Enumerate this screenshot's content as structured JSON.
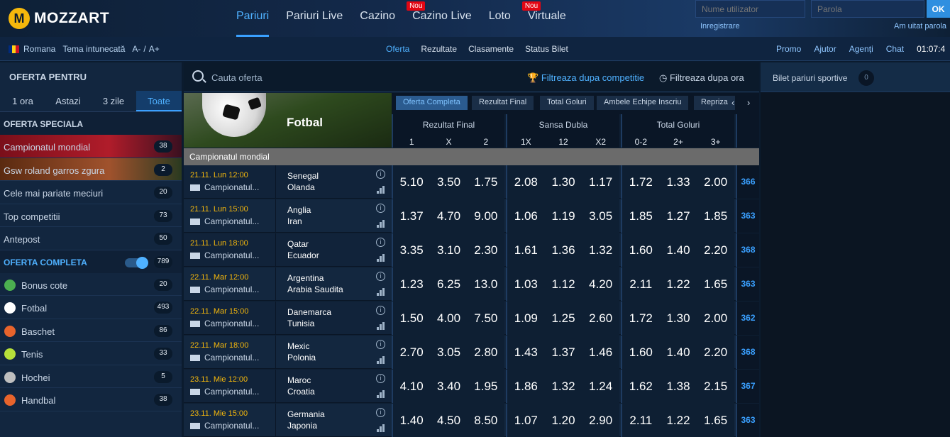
{
  "brand": {
    "logo_letter": "M",
    "name": "MOZZART",
    "accent": "#3aa0ff",
    "gold": "#f5b80c"
  },
  "main_nav": [
    {
      "label": "Pariuri",
      "active": true,
      "badge": ""
    },
    {
      "label": "Pariuri Live",
      "active": false,
      "badge": ""
    },
    {
      "label": "Cazino",
      "active": false,
      "badge": ""
    },
    {
      "label": "Cazino Live",
      "active": false,
      "badge": "Nou"
    },
    {
      "label": "Loto",
      "active": false,
      "badge": ""
    },
    {
      "label": "Virtuale",
      "active": false,
      "badge": "Nou"
    }
  ],
  "login": {
    "user_placeholder": "Nume utilizator",
    "pass_placeholder": "Parola",
    "ok": "OK",
    "register": "Inregistrare",
    "forgot": "Am uitat parola"
  },
  "subbar": {
    "language": "Romana",
    "theme": "Tema intunecată",
    "font_small": "A-",
    "font_sep": "/",
    "font_big": "A+",
    "center": [
      "Oferta",
      "Rezultate",
      "Clasamente",
      "Status Bilet"
    ],
    "right": [
      "Promo",
      "Ajutor",
      "Agenți",
      "Chat"
    ],
    "clock": "01:07:4"
  },
  "sidebar": {
    "title": "OFERTA PENTRU",
    "tabs": [
      "1 ora",
      "Astazi",
      "3 zile",
      "Toate"
    ],
    "active_tab": 3,
    "special_title": "OFERTA SPECIALA",
    "special": [
      {
        "label": "Campionatul mondial",
        "count": "38"
      },
      {
        "label": "Gsw roland garros zgura",
        "count": "2"
      },
      {
        "label": "Cele mai pariate meciuri",
        "count": "20"
      },
      {
        "label": "Top competitii",
        "count": "73"
      },
      {
        "label": "Antepost",
        "count": "50"
      }
    ],
    "complete_title": "OFERTA COMPLETA",
    "complete_count": "789",
    "sports": [
      {
        "label": "Bonus cote",
        "count": "20",
        "icon": "bonus-icon",
        "color": "#4caf50"
      },
      {
        "label": "Fotbal",
        "count": "493",
        "icon": "football-icon",
        "color": "#ffffff"
      },
      {
        "label": "Baschet",
        "count": "86",
        "icon": "basketball-icon",
        "color": "#e8642c"
      },
      {
        "label": "Tenis",
        "count": "33",
        "icon": "tennis-icon",
        "color": "#b6e03a"
      },
      {
        "label": "Hochei",
        "count": "5",
        "icon": "hockey-icon",
        "color": "#bfbfbf"
      },
      {
        "label": "Handbal",
        "count": "38",
        "icon": "handball-icon",
        "color": "#e8642c"
      }
    ]
  },
  "search": {
    "placeholder": "Cauta oferta",
    "filter_competition": "Filtreaza dupa competitie",
    "filter_time": "Filtreaza dupa ora"
  },
  "hero": {
    "sport": "Fotbal"
  },
  "market_tabs": [
    "Oferta Completa",
    "Rezultat Final",
    "Total Goluri",
    "Ambele Echipe Inscriu",
    "Repriza"
  ],
  "markets": [
    {
      "title": "Rezultat Final",
      "selections": [
        "1",
        "X",
        "2"
      ]
    },
    {
      "title": "Sansa Dubla",
      "selections": [
        "1X",
        "12",
        "X2"
      ]
    },
    {
      "title": "Total Goluri",
      "selections": [
        "0-2",
        "2+",
        "3+"
      ]
    }
  ],
  "competition": "Campionatul mondial",
  "events": [
    {
      "time": "21.11. Lun 12:00",
      "comp": "Campionatul...",
      "home": "Senegal",
      "away": "Olanda",
      "odds": [
        "5.10",
        "3.50",
        "1.75",
        "2.08",
        "1.30",
        "1.17",
        "1.72",
        "1.33",
        "2.00"
      ],
      "more": "366"
    },
    {
      "time": "21.11. Lun 15:00",
      "comp": "Campionatul...",
      "home": "Anglia",
      "away": "Iran",
      "odds": [
        "1.37",
        "4.70",
        "9.00",
        "1.06",
        "1.19",
        "3.05",
        "1.85",
        "1.27",
        "1.85"
      ],
      "more": "363"
    },
    {
      "time": "21.11. Lun 18:00",
      "comp": "Campionatul...",
      "home": "Qatar",
      "away": "Ecuador",
      "odds": [
        "3.35",
        "3.10",
        "2.30",
        "1.61",
        "1.36",
        "1.32",
        "1.60",
        "1.40",
        "2.20"
      ],
      "more": "368"
    },
    {
      "time": "22.11. Mar 12:00",
      "comp": "Campionatul...",
      "home": "Argentina",
      "away": "Arabia Saudita",
      "odds": [
        "1.23",
        "6.25",
        "13.0",
        "1.03",
        "1.12",
        "4.20",
        "2.11",
        "1.22",
        "1.65"
      ],
      "more": "363"
    },
    {
      "time": "22.11. Mar 15:00",
      "comp": "Campionatul...",
      "home": "Danemarca",
      "away": "Tunisia",
      "odds": [
        "1.50",
        "4.00",
        "7.50",
        "1.09",
        "1.25",
        "2.60",
        "1.72",
        "1.30",
        "2.00"
      ],
      "more": "362"
    },
    {
      "time": "22.11. Mar 18:00",
      "comp": "Campionatul...",
      "home": "Mexic",
      "away": "Polonia",
      "odds": [
        "2.70",
        "3.05",
        "2.80",
        "1.43",
        "1.37",
        "1.46",
        "1.60",
        "1.40",
        "2.20"
      ],
      "more": "368"
    },
    {
      "time": "23.11. Mie 12:00",
      "comp": "Campionatul...",
      "home": "Maroc",
      "away": "Croatia",
      "odds": [
        "4.10",
        "3.40",
        "1.95",
        "1.86",
        "1.32",
        "1.24",
        "1.62",
        "1.38",
        "2.15"
      ],
      "more": "367"
    },
    {
      "time": "23.11. Mie 15:00",
      "comp": "Campionatul...",
      "home": "Germania",
      "away": "Japonia",
      "odds": [
        "1.40",
        "4.50",
        "8.50",
        "1.07",
        "1.20",
        "2.90",
        "2.11",
        "1.22",
        "1.65"
      ],
      "more": "363"
    }
  ],
  "betslip": {
    "title": "Bilet pariuri sportive",
    "count": "0"
  }
}
